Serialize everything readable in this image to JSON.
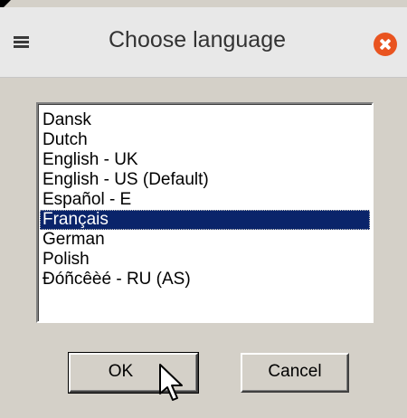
{
  "dialog": {
    "title": "Choose language",
    "menu_icon": "hamburger-menu-icon",
    "close_icon": "close-icon",
    "accent_color": "#e95420"
  },
  "language_list": {
    "selected": "Français",
    "selection_color": "#0a246a",
    "items": [
      {
        "label": "Dansk"
      },
      {
        "label": "Dutch"
      },
      {
        "label": "English - UK"
      },
      {
        "label": "English - US (Default)"
      },
      {
        "label": "Español - E"
      },
      {
        "label": "Français"
      },
      {
        "label": "German"
      },
      {
        "label": "Polish"
      },
      {
        "label": "Ðóñcêèé - RU (AS)"
      }
    ]
  },
  "buttons": {
    "ok_label": "OK",
    "cancel_label": "Cancel"
  },
  "cursor_icon": "mouse-pointer-icon"
}
